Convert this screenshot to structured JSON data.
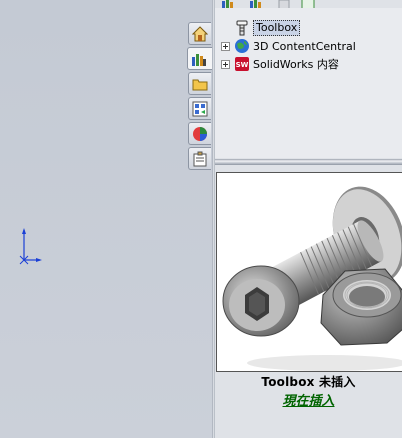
{
  "tree": {
    "items": [
      {
        "label": "Toolbox",
        "icon": "toolbox-icon",
        "selected": true
      },
      {
        "label": "3D ContentCentral",
        "icon": "globe-icon",
        "expandable": true
      },
      {
        "label": "SolidWorks 内容",
        "icon": "solidworks-icon",
        "expandable": true
      }
    ]
  },
  "side_tabs": [
    "home-icon",
    "design-library-icon",
    "file-explorer-icon",
    "view-palette-icon",
    "appearances-icon",
    "custom-properties-icon"
  ],
  "preview": {
    "status": "Toolbox 未插入",
    "insert_link": "現在插入"
  },
  "colors": {
    "link": "#006400",
    "axis": "#1a3fd6"
  }
}
